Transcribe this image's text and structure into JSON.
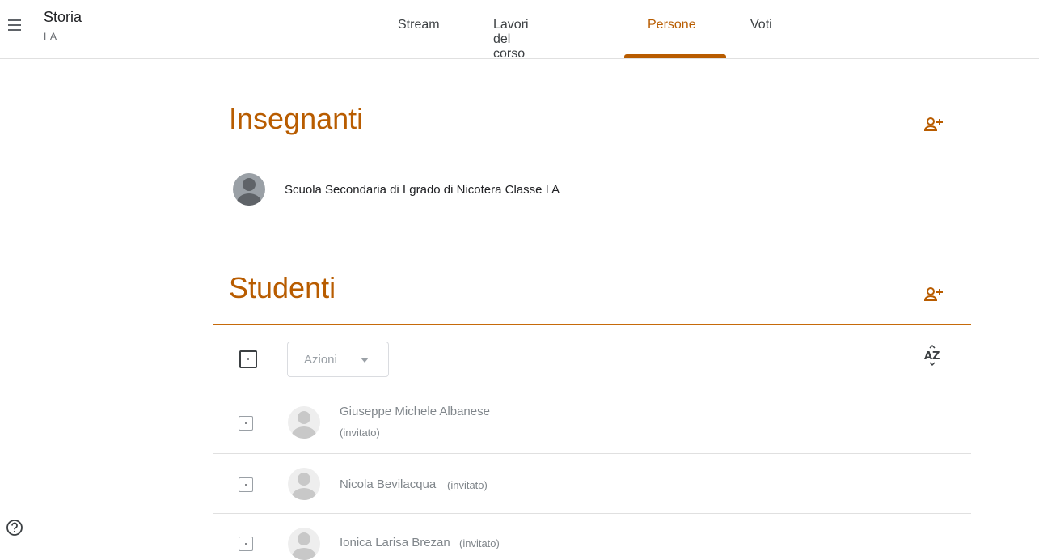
{
  "header": {
    "class_name": "Storia",
    "class_section": "I A",
    "menu_icon": "menu-icon"
  },
  "tabs": [
    {
      "label": "Stream",
      "active": false
    },
    {
      "label": "Lavori del corso",
      "active": false
    },
    {
      "label": "Persone",
      "active": true
    },
    {
      "label": "Voti",
      "active": false
    }
  ],
  "teachers": {
    "title": "Insegnanti",
    "add_icon": "add-person-icon",
    "items": [
      {
        "name": "Scuola Secondaria di I grado di Nicotera Classe I A"
      }
    ]
  },
  "students": {
    "title": "Studenti",
    "add_icon": "add-person-icon",
    "actions_label": "Azioni",
    "sort_label": "AZ",
    "items": [
      {
        "name": "Giuseppe Michele Albanese",
        "status": "(invitato)"
      },
      {
        "name": "Nicola Bevilacqua",
        "status": "(invitato)"
      },
      {
        "name": "Ionica Larisa Brezan",
        "status": "(invitato)"
      }
    ]
  },
  "colors": {
    "accent": "#b85c00",
    "text": "#202124",
    "muted": "#80868b"
  },
  "help_icon": "help-icon"
}
